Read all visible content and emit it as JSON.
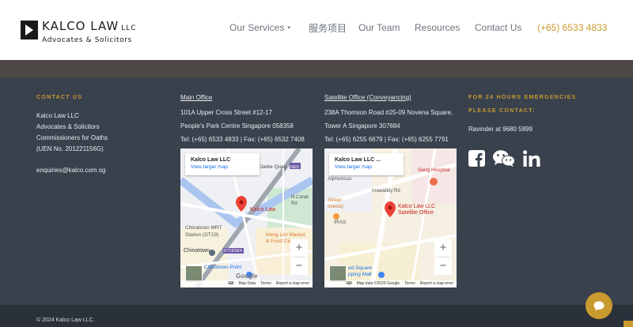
{
  "header": {
    "logo_name": "KALCO LAW",
    "logo_llc": "LLC",
    "logo_sub": "Advocates & Solicitors",
    "nav": [
      {
        "label": "Our Services",
        "has_dropdown": true
      },
      {
        "label": "服务项目"
      },
      {
        "label": "Our Team"
      },
      {
        "label": "Resources"
      },
      {
        "label": "Contact Us"
      }
    ],
    "phone": "(+65) 6533 4833"
  },
  "contact": {
    "title": "CONTACT US",
    "lines": [
      "Kalco Law LLC",
      "Advocates & Solicitors",
      "Commissioners for Oaths",
      "(UEN No. 201221156G)"
    ],
    "email": "enquiries@kalco.com.sg"
  },
  "main_office": {
    "title": "Main Office",
    "address1": "101A Upper Cross Street #12-17",
    "address2": "People's Park Centre Singapore 058358",
    "tel": "Tel: (+65) 6533 4833 | Fax: (+65) 6532 7408",
    "map": {
      "card_title": "Kalco Law LLC",
      "card_link": "View larger map",
      "pin_label": "Kalco Law",
      "labels": {
        "quay": "Clarke Quay",
        "ne5": "NE5",
        "canal": "N Canal Rd",
        "chinatown_mrt": "Chinatown MRT",
        "station": "Station (DT19)",
        "chinatown": "Chinatown",
        "dt19": "DT19",
        "ne4": "NE4",
        "hong_lim": "Hong Lim Market",
        "food": "& Food Ce",
        "point": "Chinatown Point"
      },
      "attribution": [
        "Map Data",
        "Terms",
        "Report a map error"
      ]
    }
  },
  "satellite_office": {
    "title": "Satellite Office (Conveyancing)",
    "address1": "238A Thomson Road #25-09 Novena Square,",
    "address2": "Tower A Singapore 307684",
    "tel": "Tel: (+65) 6255 6679 | Fax: (+65) 6255 7791",
    "map": {
      "card_title": "Kalco Law LLC ...",
      "card_link": "View larger map",
      "pin_label1": "Kalco Law LLC",
      "pin_label2": "Satellite Office",
      "labels": {
        "hospital": "Seng Hospital",
        "alphonsus": "Alphonsus",
        "road": "Irrawaddy Rd",
        "street": "Street",
        "novena": "ovena)",
        "iras": "IRAS",
        "square": "ed Square",
        "mall": "pping Mall"
      },
      "attribution": [
        "Map data ©2025 Google",
        "Terms",
        "Report a map error"
      ]
    }
  },
  "emergency": {
    "title1": "FOR 24 HOURS EMERGENCIES",
    "title2": "PLEASE CONTACT:",
    "contact": "Ravinder at 9680 5899"
  },
  "social_icons": [
    "facebook-icon",
    "wechat-icon",
    "linkedin-icon"
  ],
  "footer": {
    "copyright": "© 2024 Kalco Law LLC."
  },
  "colors": {
    "accent": "#c99a2e",
    "footer_bg": "#39414d",
    "bottom_bar": "#2a313b"
  }
}
